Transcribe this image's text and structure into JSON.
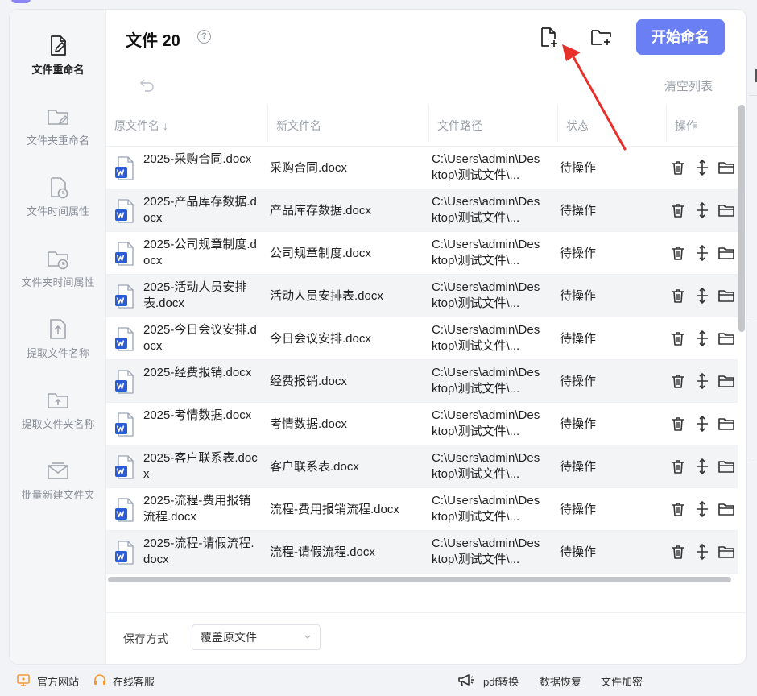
{
  "sidebar": {
    "items": [
      {
        "label": "文件重命名",
        "icon": "file-edit-icon",
        "active": true
      },
      {
        "label": "文件夹重命名",
        "icon": "folder-edit-icon"
      },
      {
        "label": "文件时间属性",
        "icon": "file-clock-icon"
      },
      {
        "label": "文件夹时间属性",
        "icon": "folder-clock-icon"
      },
      {
        "label": "提取文件名称",
        "icon": "file-upload-icon"
      },
      {
        "label": "提取文件夹名称",
        "icon": "folder-upload-icon"
      },
      {
        "label": "批量新建文件夹",
        "icon": "folder-new-icon"
      }
    ]
  },
  "header": {
    "title": "文件 20",
    "help": "?",
    "start_button": "开始命名",
    "clear_list": "清空列表"
  },
  "table": {
    "columns": [
      "原文件名 ↓",
      "新文件名",
      "文件路径",
      "状态",
      "操作"
    ],
    "rows": [
      {
        "original": "2025-采购合同.docx",
        "new": "采购合同.docx",
        "path": "C:\\Users\\admin\\Desktop\\测试文件\\...",
        "status": "待操作"
      },
      {
        "original": "2025-产品库存数据.docx",
        "new": "产品库存数据.docx",
        "path": "C:\\Users\\admin\\Desktop\\测试文件\\...",
        "status": "待操作"
      },
      {
        "original": "2025-公司规章制度.docx",
        "new": "公司规章制度.docx",
        "path": "C:\\Users\\admin\\Desktop\\测试文件\\...",
        "status": "待操作"
      },
      {
        "original": "2025-活动人员安排表.docx",
        "new": "活动人员安排表.docx",
        "path": "C:\\Users\\admin\\Desktop\\测试文件\\...",
        "status": "待操作"
      },
      {
        "original": "2025-今日会议安排.docx",
        "new": "今日会议安排.docx",
        "path": "C:\\Users\\admin\\Desktop\\测试文件\\...",
        "status": "待操作"
      },
      {
        "original": "2025-经费报销.docx",
        "new": "经费报销.docx",
        "path": "C:\\Users\\admin\\Desktop\\测试文件\\...",
        "status": "待操作"
      },
      {
        "original": "2025-考情数据.docx",
        "new": "考情数据.docx",
        "path": "C:\\Users\\admin\\Desktop\\测试文件\\...",
        "status": "待操作"
      },
      {
        "original": "2025-客户联系表.docx",
        "new": "客户联系表.docx",
        "path": "C:\\Users\\admin\\Desktop\\测试文件\\...",
        "status": "待操作"
      },
      {
        "original": "2025-流程-费用报销流程.docx",
        "new": "流程-费用报销流程.docx",
        "path": "C:\\Users\\admin\\Desktop\\测试文件\\...",
        "status": "待操作"
      },
      {
        "original": "2025-流程-请假流程.docx",
        "new": "流程-请假流程.docx",
        "path": "C:\\Users\\admin\\Desktop\\测试文件\\...",
        "status": "待操作"
      }
    ]
  },
  "save": {
    "label": "保存方式",
    "value": "覆盖原文件"
  },
  "footer": {
    "website": "官方网站",
    "support": "在线客服",
    "pdf": "pdf转换",
    "recovery": "数据恢复",
    "encrypt": "文件加密"
  },
  "colors": {
    "accent": "#6b7ff5",
    "annotation_arrow": "#e8302b",
    "word_icon": "#2b5cd6"
  }
}
